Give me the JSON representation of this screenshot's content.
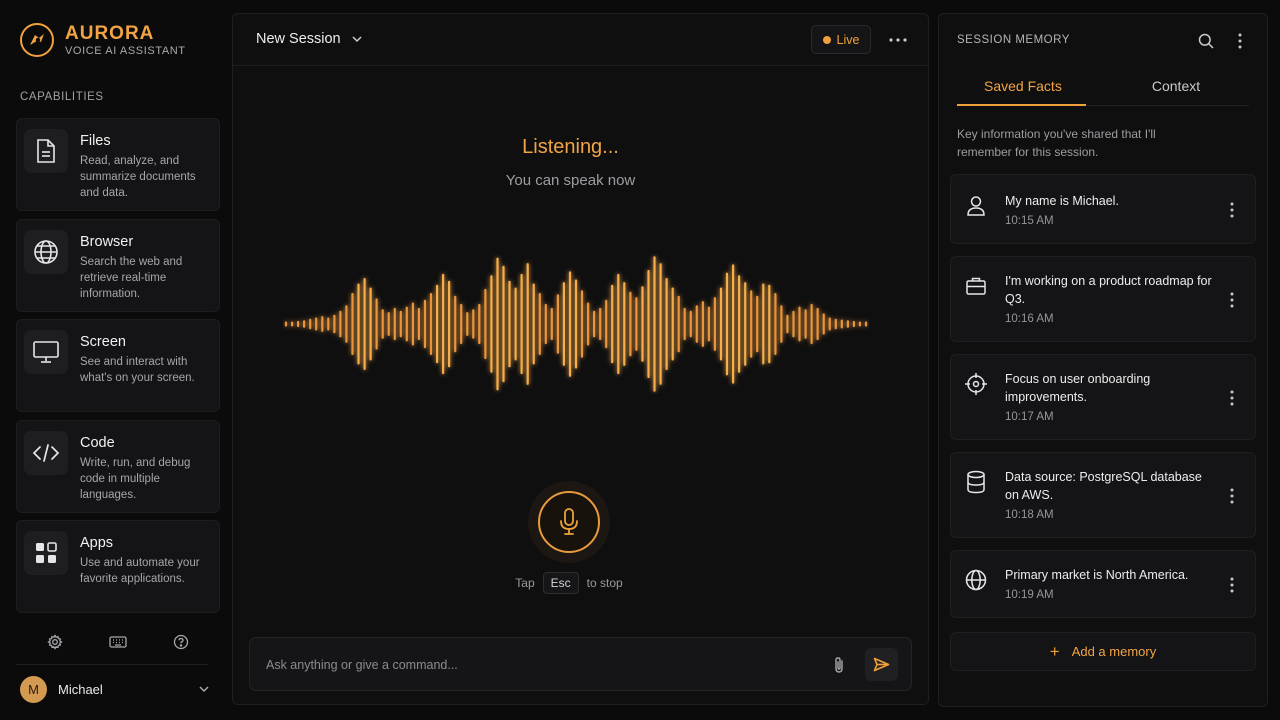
{
  "brand": {
    "name": "AURORA",
    "subtitle": "VOICE AI ASSISTANT",
    "accent": "#f0a13c"
  },
  "sidebar": {
    "section_label": "CAPABILITIES",
    "capabilities": [
      {
        "title": "Files",
        "description": "Read, analyze, and summarize documents and data.",
        "icon": "file-icon"
      },
      {
        "title": "Browser",
        "description": "Search the web and retrieve real-time information.",
        "icon": "globe-icon"
      },
      {
        "title": "Screen",
        "description": "See and interact with what's on your screen.",
        "icon": "monitor-icon"
      },
      {
        "title": "Code",
        "description": "Write, run, and debug code in multiple languages.",
        "icon": "code-icon"
      },
      {
        "title": "Apps",
        "description": "Use and automate your favorite applications.",
        "icon": "apps-grid-icon"
      }
    ],
    "utilities": [
      "gear-icon",
      "keyboard-icon",
      "help-icon"
    ],
    "user": {
      "initial": "M",
      "name": "Michael"
    }
  },
  "main": {
    "session_title": "New Session",
    "live_label": "Live",
    "status_title": "Listening...",
    "status_subtitle": "You can speak now",
    "hint_before": "Tap",
    "hint_key": "Esc",
    "hint_after": "to stop",
    "composer_placeholder": "Ask anything or give a command..."
  },
  "memory": {
    "title": "SESSION MEMORY",
    "tabs": [
      {
        "label": "Saved Facts",
        "active": true
      },
      {
        "label": "Context",
        "active": false
      }
    ],
    "description": "Key information you've shared that I'll remember for this session.",
    "items": [
      {
        "text": "My name is Michael.",
        "time": "10:15 AM",
        "icon": "user-icon"
      },
      {
        "text": "I'm working on a product roadmap for Q3.",
        "time": "10:16 AM",
        "icon": "briefcase-icon"
      },
      {
        "text": "Focus on user onboarding improvements.",
        "time": "10:17 AM",
        "icon": "target-icon"
      },
      {
        "text": "Data source: PostgreSQL database on AWS.",
        "time": "10:18 AM",
        "icon": "database-icon"
      },
      {
        "text": "Primary market is North America.",
        "time": "10:19 AM",
        "icon": "globe-icon"
      }
    ],
    "add_label": "Add a memory"
  }
}
